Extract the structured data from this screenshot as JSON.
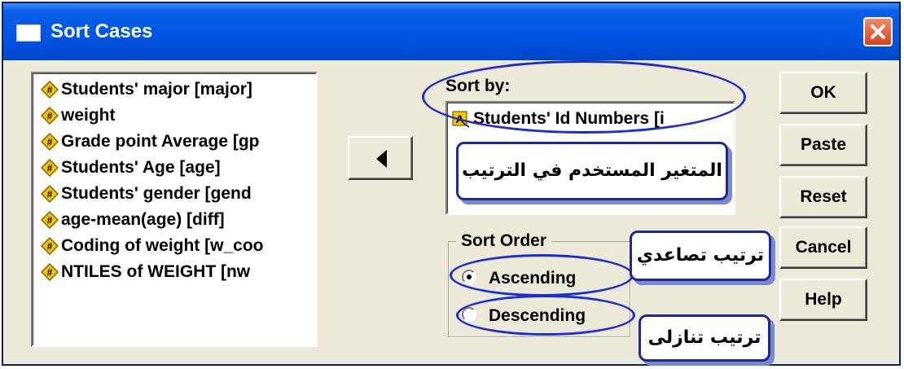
{
  "window": {
    "title": "Sort Cases"
  },
  "variables": [
    "Students' major [major]",
    "weight",
    "Grade point Average [gp",
    "Students' Age [age]",
    "Students' gender [gend",
    "age-mean(age) [diff]",
    "Coding of weight [w_coo",
    "NTILES of WEIGHT [nw"
  ],
  "sort_by": {
    "label": "Sort by:",
    "items": [
      "Students' Id Numbers [i"
    ]
  },
  "sort_order": {
    "label": "Sort Order",
    "ascending": "Ascending",
    "descending": "Descending",
    "selected": "Ascending"
  },
  "buttons": {
    "ok": "OK",
    "paste": "Paste",
    "reset": "Reset",
    "cancel": "Cancel",
    "help": "Help"
  },
  "annotations": {
    "sort_variable": "المتغير المستخدم في الترتيب",
    "ascending": "ترتيب تصاعدي",
    "descending": "ترتيب تنازلى"
  },
  "colors": {
    "titlebar": "#0054e3",
    "annotation_ring": "#1b2fd1",
    "callout_border": "#1a2a9e",
    "variable_icon": "#f5c400"
  },
  "icons": {
    "window": "window-icon",
    "close": "close-icon",
    "move": "left-arrow-icon",
    "variable": "scale-variable-icon",
    "sort_variable": "string-variable-icon"
  }
}
